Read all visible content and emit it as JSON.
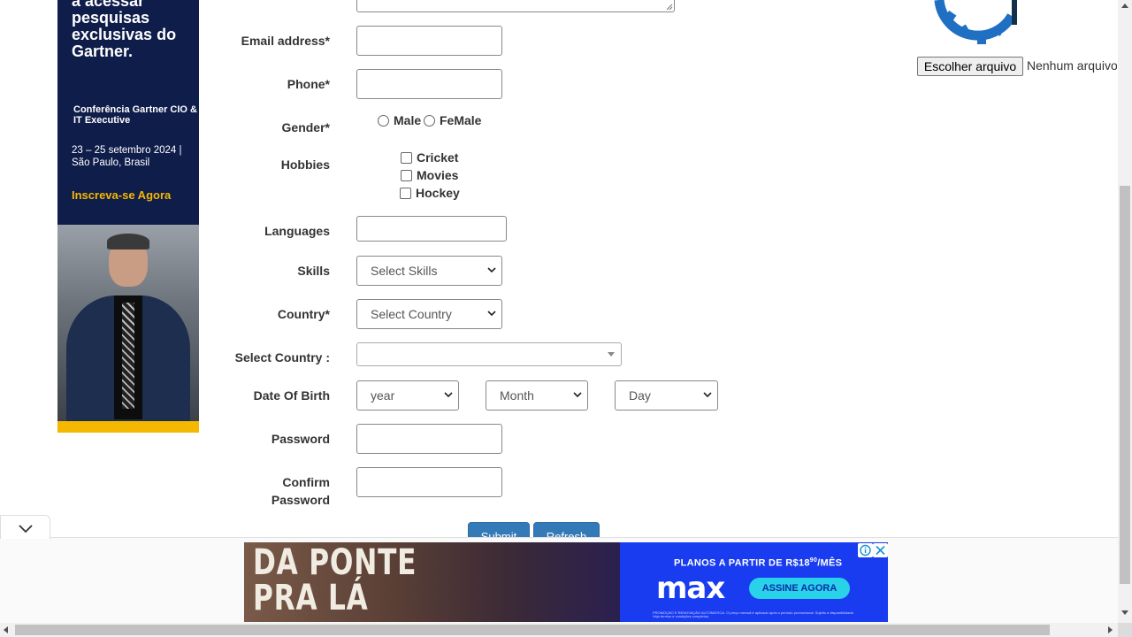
{
  "left_ad": {
    "headline": "a acessar pesquisas exclusivas do Gartner.",
    "conference": "Conferência Gartner CIO & IT Executive",
    "dates": "23 – 25 setembro 2024 | São Paulo, Brasil",
    "cta": "Inscreva-se Agora"
  },
  "form": {
    "email_label": "Email address*",
    "phone_label": "Phone*",
    "gender_label": "Gender*",
    "gender_options": [
      "Male",
      "FeMale"
    ],
    "hobbies_label": "Hobbies",
    "hobbies": [
      "Cricket",
      "Movies",
      "Hockey"
    ],
    "languages_label": "Languages",
    "skills_label": "Skills",
    "skills_selected": "Select Skills",
    "country_label": "Country*",
    "country_selected": "Select Country",
    "select_country_label": "Select Country :",
    "select_country_value": "",
    "dob_label": "Date Of Birth",
    "dob_year": "year",
    "dob_month": "Month",
    "dob_day": "Day",
    "password_label": "Password",
    "confirm_password_label_line1": "Confirm",
    "confirm_password_label_line2": "Password",
    "submit_label": "Submit",
    "refresh_label": "Refresh"
  },
  "file_upload": {
    "choose_label": "Escolher arquivo",
    "no_file_label": "Nenhum arquivo"
  },
  "bottom_ad": {
    "tagline_line1": "DA PONTE",
    "tagline_line2": "PRA LÁ",
    "price_prefix": "PLANOS A PARTIR DE R$18",
    "price_cents": "90",
    "price_suffix": "/MÊS",
    "logo": "max",
    "cta": "ASSINE AGORA",
    "fine_print": "PROMOÇÃO E RENOVAÇÃO AUTOMÁTICA. O preço mensal é aplicado após o período promocional. Sujeito a disponibilidade. Veja termos e condições completos."
  },
  "colors": {
    "primary_button": "#337ab7",
    "left_ad_bg": "#0f1d4a",
    "left_ad_accent": "#f5b800",
    "bottom_ad_bg": "#1a3cf0",
    "bottom_ad_cta": "#29d2e8",
    "gear_logo": "#1f6fc2"
  }
}
